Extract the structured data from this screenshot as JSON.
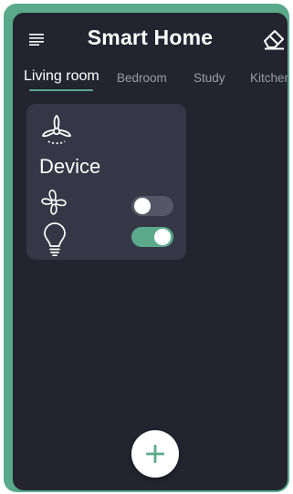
{
  "header": {
    "title": "Smart Home",
    "menu_icon": "menu-icon",
    "action_icon": "eraser-icon"
  },
  "tabs": [
    {
      "label": "Living room",
      "active": true
    },
    {
      "label": "Bedroom",
      "active": false
    },
    {
      "label": "Study",
      "active": false
    },
    {
      "label": "Kitchen",
      "active": false
    }
  ],
  "card": {
    "title": "Device",
    "icon": "ceiling-fan-icon",
    "controls": [
      {
        "icon": "fan-icon",
        "state": "off"
      },
      {
        "icon": "light-bulb-icon",
        "state": "on"
      }
    ]
  },
  "fab": {
    "icon": "plus-icon"
  },
  "colors": {
    "frame": "#5aa98b",
    "background": "#232430",
    "card": "#363746",
    "accent": "#5aa98b",
    "toggle_off": "#555766",
    "text": "#ffffff",
    "muted_text": "#9a9ca6"
  }
}
